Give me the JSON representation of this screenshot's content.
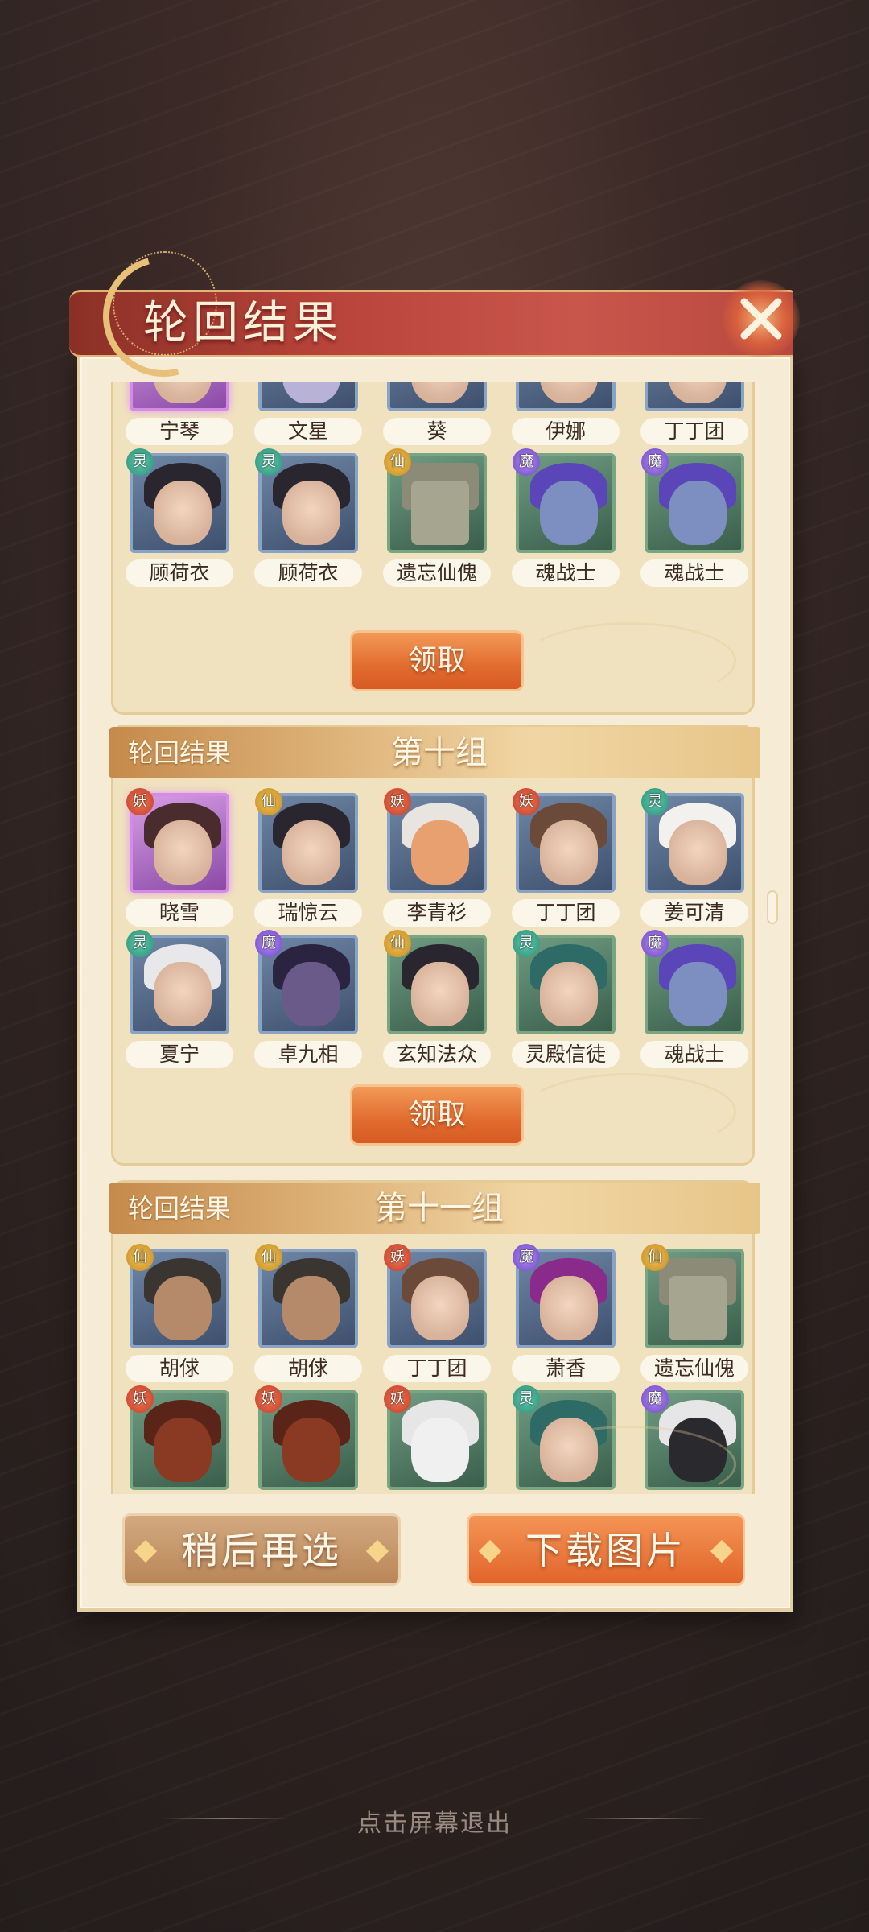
{
  "popup": {
    "title": "轮回结果",
    "close_icon": "close-x-icon"
  },
  "badge_types": {
    "ling": "灵",
    "xian": "仙",
    "yao": "妖",
    "mo": "魔"
  },
  "group_prev": {
    "row1": [
      "宁琴",
      "文星",
      "葵",
      "伊娜",
      "丁丁团"
    ],
    "row2": [
      {
        "name": "顾荷衣",
        "badge": "灵"
      },
      {
        "name": "顾荷衣",
        "badge": "灵"
      },
      {
        "name": "遗忘仙傀",
        "badge": "仙"
      },
      {
        "name": "魂战士",
        "badge": "魔"
      },
      {
        "name": "魂战士",
        "badge": "魔"
      }
    ],
    "claim_label": "领取"
  },
  "group10": {
    "header_label": "轮回结果",
    "group_name": "第十组",
    "row1": [
      {
        "name": "晓雪",
        "badge": "妖"
      },
      {
        "name": "瑞惊云",
        "badge": "仙"
      },
      {
        "name": "李青衫",
        "badge": "妖"
      },
      {
        "name": "丁丁团",
        "badge": "妖"
      },
      {
        "name": "姜可清",
        "badge": "灵"
      }
    ],
    "row2": [
      {
        "name": "夏宁",
        "badge": "灵"
      },
      {
        "name": "卓九相",
        "badge": "魔"
      },
      {
        "name": "玄知法众",
        "badge": "仙"
      },
      {
        "name": "灵殿信徒",
        "badge": "灵"
      },
      {
        "name": "魂战士",
        "badge": "魔"
      }
    ],
    "claim_label": "领取"
  },
  "group11": {
    "header_label": "轮回结果",
    "group_name": "第十一组",
    "row1": [
      {
        "name": "胡俅",
        "badge": "仙"
      },
      {
        "name": "胡俅",
        "badge": "仙"
      },
      {
        "name": "丁丁团",
        "badge": "妖"
      },
      {
        "name": "萧香",
        "badge": "魔"
      },
      {
        "name": "遗忘仙傀",
        "badge": "仙"
      }
    ],
    "row2_badges": [
      "妖",
      "妖",
      "妖",
      "灵",
      "魔"
    ]
  },
  "buttons": {
    "later": "稍后再选",
    "download": "下载图片"
  },
  "exit_hint": "点击屏幕退出"
}
